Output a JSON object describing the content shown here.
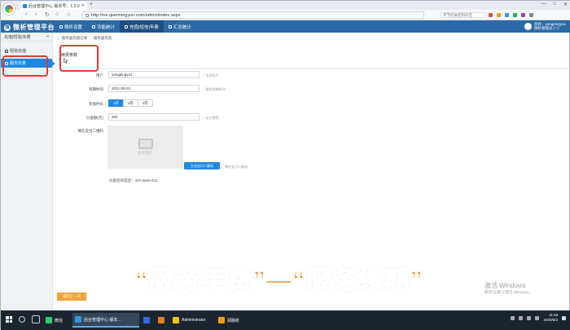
{
  "browser": {
    "tab_title": "后台管理中心 版本号：1.2.0",
    "new_tab": "+",
    "url": "http://wx.qianmingyun.com/admin/index.aspx",
    "search_placeholder": "字节控被拒和抖音",
    "window_controls": [
      "—",
      "□",
      "✕"
    ]
  },
  "app": {
    "logo_text": "微析管理平台",
    "nav": [
      {
        "label": "微析设置",
        "icon": "gear-icon"
      },
      {
        "label": "功能统计",
        "icon": "chart-icon"
      },
      {
        "label": "充值|短信|年费",
        "icon": "money-icon",
        "active": true
      },
      {
        "label": "汇总统计",
        "icon": "summary-icon"
      }
    ],
    "user": {
      "line1": "您好，yangpingyu1",
      "line2": "微析管理员☆☆"
    }
  },
  "sidebar": {
    "header": "充值|短信|年费",
    "collapse": "«",
    "items": [
      {
        "label": "短信充值",
        "active": false
      },
      {
        "label": "服务年费",
        "active": true
      }
    ]
  },
  "content": {
    "breadcrumb": [
      "服务器充值记录",
      "服务器充值"
    ],
    "tab": "续费参数",
    "form": {
      "user_label": "用户",
      "user_value": "yangpingyu1",
      "user_hint": "* 当前用户",
      "expire_label": "到期时间",
      "expire_value": "2021-08-03",
      "expire_hint": "* 服务到期时间",
      "period_label": "充值时长",
      "period_options": [
        {
          "label": "1年",
          "selected": true
        },
        {
          "label": "2年",
          "selected": false
        },
        {
          "label": "3年",
          "selected": false
        }
      ],
      "amount_label": "价金额(元)",
      "amount_value": "300",
      "amount_hint": "* 支付费用",
      "qr_label": "微信支付二维码",
      "qr_placeholder": "暂无图片",
      "gen_button": "生成支付二维码",
      "gen_hint": "微信支付二维码",
      "phone": "问题咨询电话：400-9655-622"
    },
    "back_button": "返回上一页"
  },
  "overlay": {
    "caption": "“服务年费”—“服务续期”",
    "watermark_line1": "激活 Windows",
    "watermark_line2": "转到“设置”以激活 Windows。"
  },
  "taskbar": {
    "apps": [
      {
        "label": "微信",
        "color": "#2ecc71"
      },
      {
        "label": "后台管理中心 版本...",
        "color": "#3498db",
        "active": true
      },
      {
        "label": "",
        "color": "#2d6cdf"
      },
      {
        "label": "",
        "color": "#e67e22"
      },
      {
        "label": "Administrator",
        "color": "#f1c40f"
      },
      {
        "label": "郑融析",
        "color": "#f39c12"
      }
    ],
    "time": "11:48",
    "date": "2020/6/3"
  }
}
